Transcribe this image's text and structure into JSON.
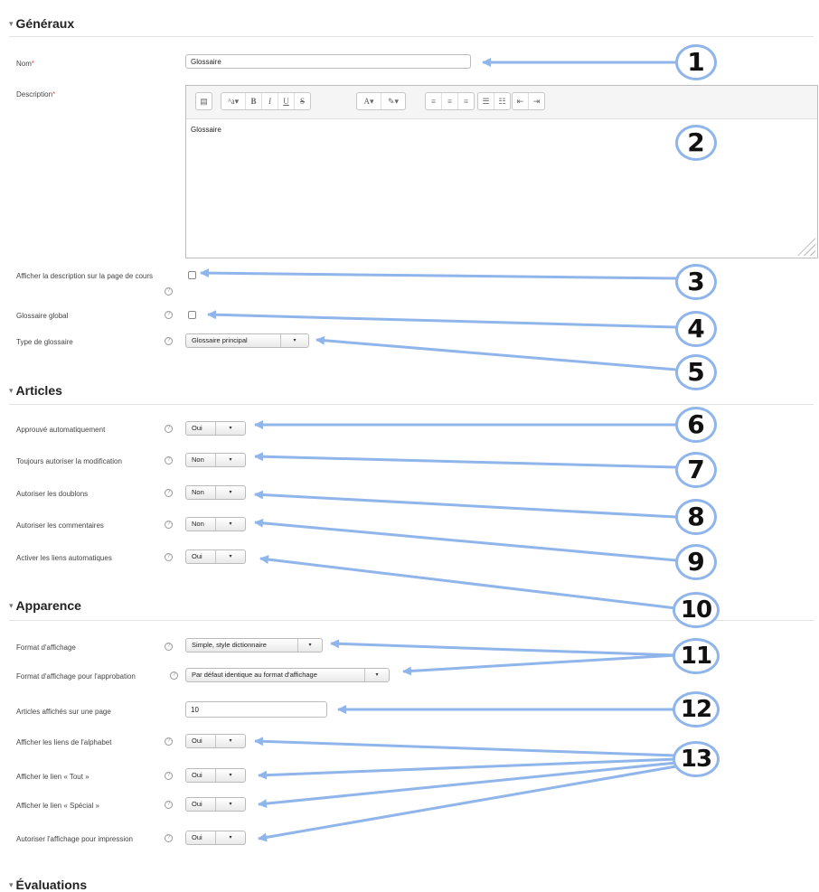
{
  "sections": {
    "generaux": "Généraux",
    "articles": "Articles",
    "apparence": "Apparence",
    "evaluations": "Évaluations"
  },
  "generaux": {
    "nom_label": "Nom",
    "nom_value": "Glossaire",
    "description_label": "Description",
    "description_value": "Glossaire",
    "toolbar_icons": [
      "table-icon",
      "font-size-icon",
      "bold-icon",
      "italic-icon",
      "underline-icon",
      "strikethrough-icon",
      "font-color-icon",
      "highlight-icon",
      "align-left-icon",
      "align-center-icon",
      "align-right-icon",
      "bullet-list-icon",
      "numbered-list-icon",
      "outdent-icon",
      "indent-icon"
    ],
    "afficher_desc_label": "Afficher la description sur la page de cours",
    "afficher_desc_checked": false,
    "glossaire_global_label": "Glossaire global",
    "glossaire_global_checked": false,
    "type_label": "Type de glossaire",
    "type_value": "Glossaire principal"
  },
  "articles": {
    "approuve_label": "Approuvé automatiquement",
    "approuve_value": "Oui",
    "modif_label": "Toujours autoriser la modification",
    "modif_value": "Non",
    "doublons_label": "Autoriser les doublons",
    "doublons_value": "Non",
    "commentaires_label": "Autoriser les commentaires",
    "commentaires_value": "Non",
    "liens_label": "Activer les liens automatiques",
    "liens_value": "Oui"
  },
  "apparence": {
    "format_label": "Format d'affichage",
    "format_value": "Simple, style dictionnaire",
    "format_approb_label": "Format d'affichage pour l'approbation",
    "format_approb_value": "Par défaut identique au format d'affichage",
    "articles_page_label": "Articles affichés sur une page",
    "articles_page_value": "10",
    "alphabet_label": "Afficher les liens de l'alphabet",
    "alphabet_value": "Oui",
    "tout_label": "Afficher le lien « Tout »",
    "tout_value": "Oui",
    "special_label": "Afficher le lien « Spécial »",
    "special_value": "Oui",
    "impression_label": "Autoriser l'affichage pour impression",
    "impression_value": "Oui"
  },
  "callouts": [
    "1",
    "2",
    "3",
    "4",
    "5",
    "6",
    "7",
    "8",
    "9",
    "10",
    "11",
    "12",
    "13"
  ],
  "colors": {
    "callout": "#8fb5ea",
    "required": "#d9534f"
  }
}
